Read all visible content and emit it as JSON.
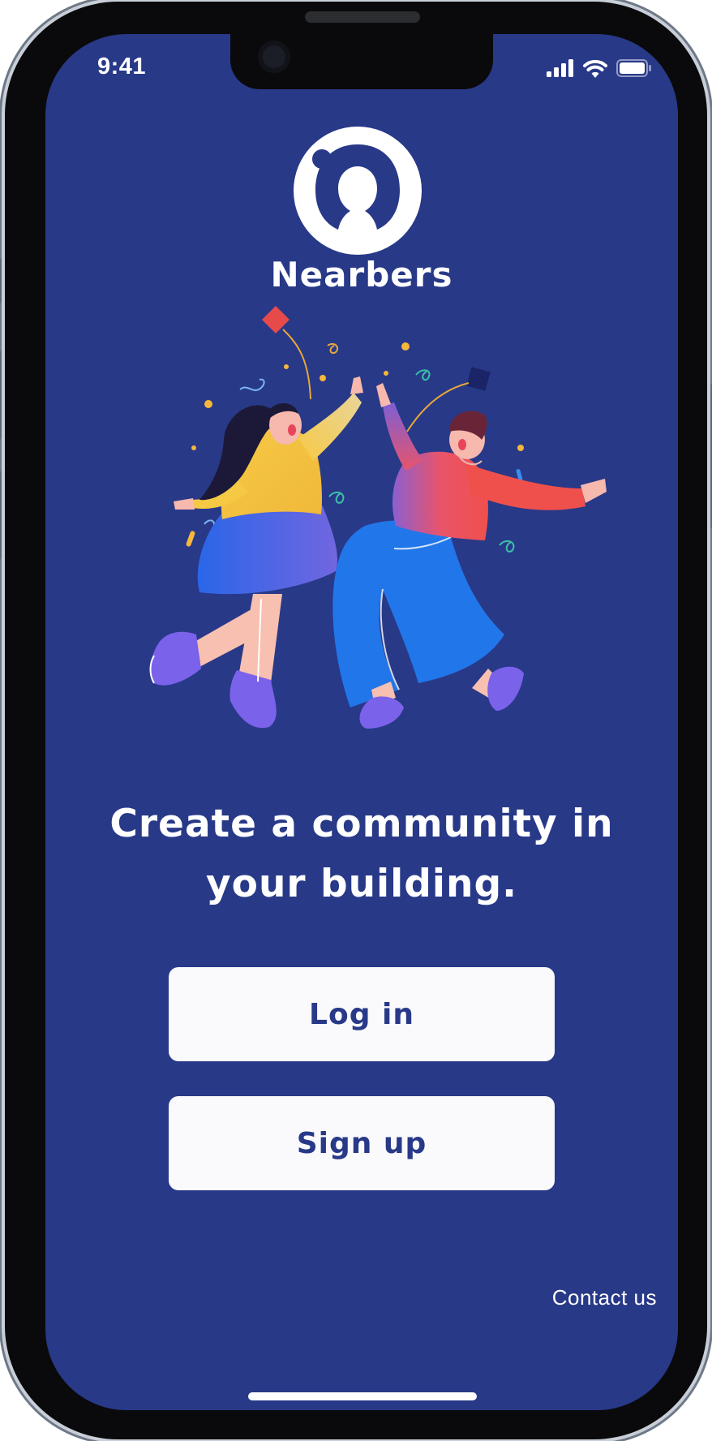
{
  "status_bar": {
    "time": "9:41",
    "icons": [
      "cellular-signal-icon",
      "wifi-icon",
      "battery-icon"
    ]
  },
  "app": {
    "name": "Nearbers",
    "logo_icon": "nearbers-logo-icon"
  },
  "main": {
    "tagline": "Create a community in your building.",
    "illustration": "people-high-five-illustration"
  },
  "buttons": {
    "login_label": "Log in",
    "signup_label": "Sign up"
  },
  "footer": {
    "contact_label": "Contact us"
  },
  "colors": {
    "background": "#283988",
    "button_background": "#fafafc",
    "button_text": "#283988",
    "text": "#ffffff"
  }
}
